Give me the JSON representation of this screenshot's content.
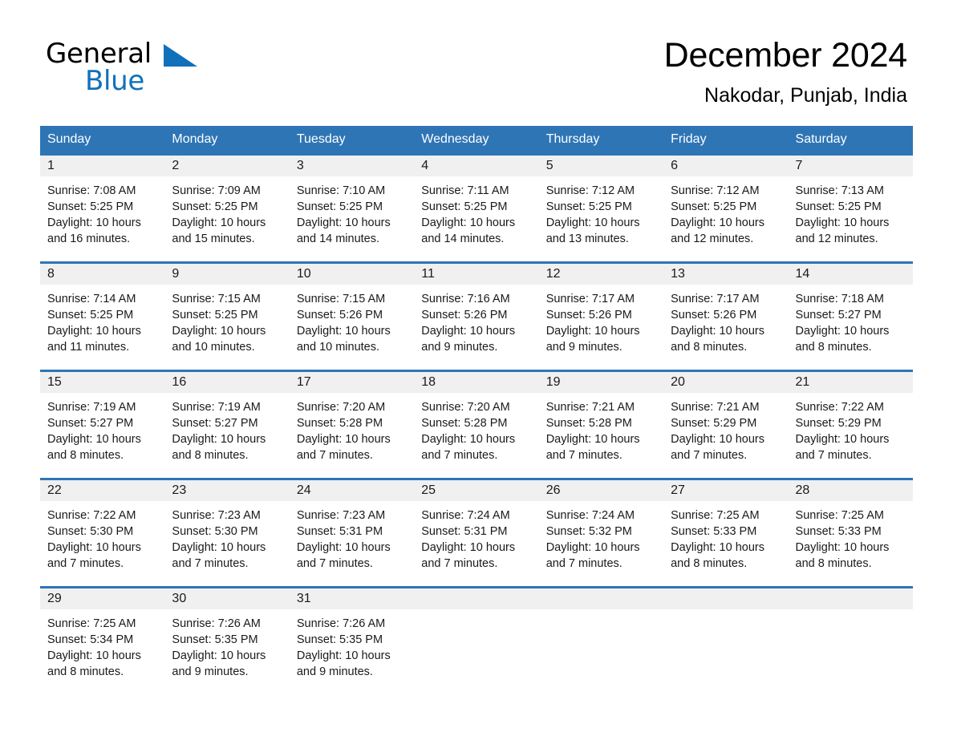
{
  "brand": {
    "name_part1": "General",
    "name_part2": "Blue",
    "accent_color": "#1071ba"
  },
  "header": {
    "title": "December 2024",
    "location": "Nakodar, Punjab, India",
    "header_bg_color": "#2e75b6",
    "row_divider_color": "#2e75b6",
    "daynum_band_color": "#f0f0f0"
  },
  "weekday_headers": [
    "Sunday",
    "Monday",
    "Tuesday",
    "Wednesday",
    "Thursday",
    "Friday",
    "Saturday"
  ],
  "weeks": [
    [
      {
        "day": "1",
        "sunrise": "Sunrise: 7:08 AM",
        "sunset": "Sunset: 5:25 PM",
        "daylight_1": "Daylight: 10 hours",
        "daylight_2": "and 16 minutes."
      },
      {
        "day": "2",
        "sunrise": "Sunrise: 7:09 AM",
        "sunset": "Sunset: 5:25 PM",
        "daylight_1": "Daylight: 10 hours",
        "daylight_2": "and 15 minutes."
      },
      {
        "day": "3",
        "sunrise": "Sunrise: 7:10 AM",
        "sunset": "Sunset: 5:25 PM",
        "daylight_1": "Daylight: 10 hours",
        "daylight_2": "and 14 minutes."
      },
      {
        "day": "4",
        "sunrise": "Sunrise: 7:11 AM",
        "sunset": "Sunset: 5:25 PM",
        "daylight_1": "Daylight: 10 hours",
        "daylight_2": "and 14 minutes."
      },
      {
        "day": "5",
        "sunrise": "Sunrise: 7:12 AM",
        "sunset": "Sunset: 5:25 PM",
        "daylight_1": "Daylight: 10 hours",
        "daylight_2": "and 13 minutes."
      },
      {
        "day": "6",
        "sunrise": "Sunrise: 7:12 AM",
        "sunset": "Sunset: 5:25 PM",
        "daylight_1": "Daylight: 10 hours",
        "daylight_2": "and 12 minutes."
      },
      {
        "day": "7",
        "sunrise": "Sunrise: 7:13 AM",
        "sunset": "Sunset: 5:25 PM",
        "daylight_1": "Daylight: 10 hours",
        "daylight_2": "and 12 minutes."
      }
    ],
    [
      {
        "day": "8",
        "sunrise": "Sunrise: 7:14 AM",
        "sunset": "Sunset: 5:25 PM",
        "daylight_1": "Daylight: 10 hours",
        "daylight_2": "and 11 minutes."
      },
      {
        "day": "9",
        "sunrise": "Sunrise: 7:15 AM",
        "sunset": "Sunset: 5:25 PM",
        "daylight_1": "Daylight: 10 hours",
        "daylight_2": "and 10 minutes."
      },
      {
        "day": "10",
        "sunrise": "Sunrise: 7:15 AM",
        "sunset": "Sunset: 5:26 PM",
        "daylight_1": "Daylight: 10 hours",
        "daylight_2": "and 10 minutes."
      },
      {
        "day": "11",
        "sunrise": "Sunrise: 7:16 AM",
        "sunset": "Sunset: 5:26 PM",
        "daylight_1": "Daylight: 10 hours",
        "daylight_2": "and 9 minutes."
      },
      {
        "day": "12",
        "sunrise": "Sunrise: 7:17 AM",
        "sunset": "Sunset: 5:26 PM",
        "daylight_1": "Daylight: 10 hours",
        "daylight_2": "and 9 minutes."
      },
      {
        "day": "13",
        "sunrise": "Sunrise: 7:17 AM",
        "sunset": "Sunset: 5:26 PM",
        "daylight_1": "Daylight: 10 hours",
        "daylight_2": "and 8 minutes."
      },
      {
        "day": "14",
        "sunrise": "Sunrise: 7:18 AM",
        "sunset": "Sunset: 5:27 PM",
        "daylight_1": "Daylight: 10 hours",
        "daylight_2": "and 8 minutes."
      }
    ],
    [
      {
        "day": "15",
        "sunrise": "Sunrise: 7:19 AM",
        "sunset": "Sunset: 5:27 PM",
        "daylight_1": "Daylight: 10 hours",
        "daylight_2": "and 8 minutes."
      },
      {
        "day": "16",
        "sunrise": "Sunrise: 7:19 AM",
        "sunset": "Sunset: 5:27 PM",
        "daylight_1": "Daylight: 10 hours",
        "daylight_2": "and 8 minutes."
      },
      {
        "day": "17",
        "sunrise": "Sunrise: 7:20 AM",
        "sunset": "Sunset: 5:28 PM",
        "daylight_1": "Daylight: 10 hours",
        "daylight_2": "and 7 minutes."
      },
      {
        "day": "18",
        "sunrise": "Sunrise: 7:20 AM",
        "sunset": "Sunset: 5:28 PM",
        "daylight_1": "Daylight: 10 hours",
        "daylight_2": "and 7 minutes."
      },
      {
        "day": "19",
        "sunrise": "Sunrise: 7:21 AM",
        "sunset": "Sunset: 5:28 PM",
        "daylight_1": "Daylight: 10 hours",
        "daylight_2": "and 7 minutes."
      },
      {
        "day": "20",
        "sunrise": "Sunrise: 7:21 AM",
        "sunset": "Sunset: 5:29 PM",
        "daylight_1": "Daylight: 10 hours",
        "daylight_2": "and 7 minutes."
      },
      {
        "day": "21",
        "sunrise": "Sunrise: 7:22 AM",
        "sunset": "Sunset: 5:29 PM",
        "daylight_1": "Daylight: 10 hours",
        "daylight_2": "and 7 minutes."
      }
    ],
    [
      {
        "day": "22",
        "sunrise": "Sunrise: 7:22 AM",
        "sunset": "Sunset: 5:30 PM",
        "daylight_1": "Daylight: 10 hours",
        "daylight_2": "and 7 minutes."
      },
      {
        "day": "23",
        "sunrise": "Sunrise: 7:23 AM",
        "sunset": "Sunset: 5:30 PM",
        "daylight_1": "Daylight: 10 hours",
        "daylight_2": "and 7 minutes."
      },
      {
        "day": "24",
        "sunrise": "Sunrise: 7:23 AM",
        "sunset": "Sunset: 5:31 PM",
        "daylight_1": "Daylight: 10 hours",
        "daylight_2": "and 7 minutes."
      },
      {
        "day": "25",
        "sunrise": "Sunrise: 7:24 AM",
        "sunset": "Sunset: 5:31 PM",
        "daylight_1": "Daylight: 10 hours",
        "daylight_2": "and 7 minutes."
      },
      {
        "day": "26",
        "sunrise": "Sunrise: 7:24 AM",
        "sunset": "Sunset: 5:32 PM",
        "daylight_1": "Daylight: 10 hours",
        "daylight_2": "and 7 minutes."
      },
      {
        "day": "27",
        "sunrise": "Sunrise: 7:25 AM",
        "sunset": "Sunset: 5:33 PM",
        "daylight_1": "Daylight: 10 hours",
        "daylight_2": "and 8 minutes."
      },
      {
        "day": "28",
        "sunrise": "Sunrise: 7:25 AM",
        "sunset": "Sunset: 5:33 PM",
        "daylight_1": "Daylight: 10 hours",
        "daylight_2": "and 8 minutes."
      }
    ],
    [
      {
        "day": "29",
        "sunrise": "Sunrise: 7:25 AM",
        "sunset": "Sunset: 5:34 PM",
        "daylight_1": "Daylight: 10 hours",
        "daylight_2": "and 8 minutes."
      },
      {
        "day": "30",
        "sunrise": "Sunrise: 7:26 AM",
        "sunset": "Sunset: 5:35 PM",
        "daylight_1": "Daylight: 10 hours",
        "daylight_2": "and 9 minutes."
      },
      {
        "day": "31",
        "sunrise": "Sunrise: 7:26 AM",
        "sunset": "Sunset: 5:35 PM",
        "daylight_1": "Daylight: 10 hours",
        "daylight_2": "and 9 minutes."
      },
      {
        "day": "",
        "sunrise": "",
        "sunset": "",
        "daylight_1": "",
        "daylight_2": ""
      },
      {
        "day": "",
        "sunrise": "",
        "sunset": "",
        "daylight_1": "",
        "daylight_2": ""
      },
      {
        "day": "",
        "sunrise": "",
        "sunset": "",
        "daylight_1": "",
        "daylight_2": ""
      },
      {
        "day": "",
        "sunrise": "",
        "sunset": "",
        "daylight_1": "",
        "daylight_2": ""
      }
    ]
  ]
}
